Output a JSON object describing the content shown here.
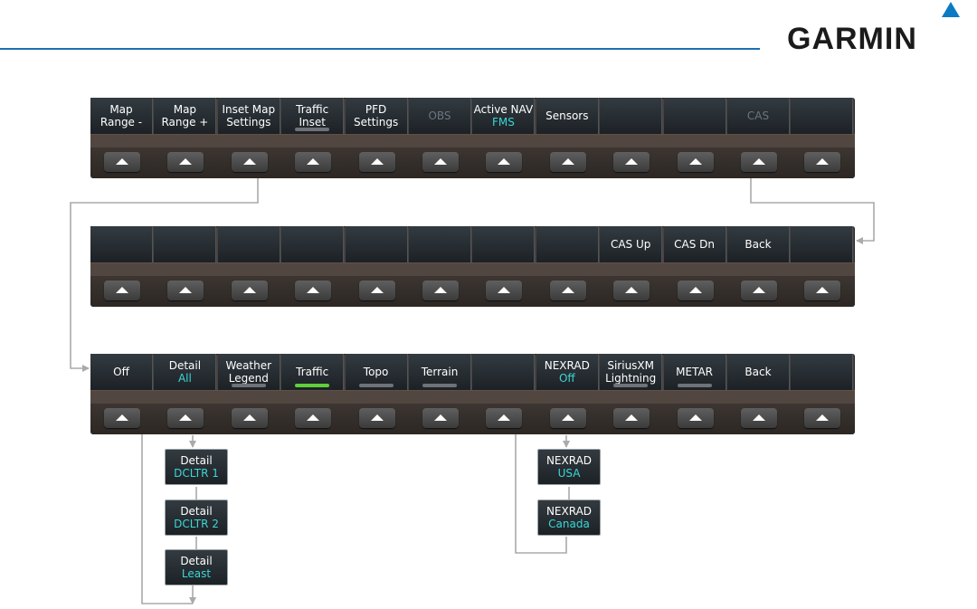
{
  "brand": {
    "logo_text": "GARMIN"
  },
  "colors": {
    "rule": "#1e6fb5",
    "value_text": "#3ad7d7",
    "indicator_on": "#5fcf3a",
    "indicator_off": "#6f7378",
    "connector": "#aaaaaa"
  },
  "top_bar": {
    "keys": [
      {
        "lines": [
          "Map",
          "Range -"
        ]
      },
      {
        "lines": [
          "Map",
          "Range +"
        ]
      },
      {
        "lines": [
          "Inset Map",
          "Settings"
        ]
      },
      {
        "lines": [
          "Traffic",
          "Inset"
        ],
        "indicator": "off"
      },
      {
        "lines": [
          "PFD",
          "Settings"
        ]
      },
      {
        "lines": [
          "OBS"
        ],
        "disabled": true
      },
      {
        "lines": [
          "Active NAV",
          "FMS"
        ],
        "value_line": 1
      },
      {
        "lines": [
          "Sensors"
        ]
      },
      {
        "lines": []
      },
      {
        "lines": []
      },
      {
        "lines": [
          "CAS"
        ],
        "disabled": true
      },
      {
        "lines": []
      }
    ]
  },
  "cas_bar": {
    "keys": [
      {
        "lines": []
      },
      {
        "lines": []
      },
      {
        "lines": []
      },
      {
        "lines": []
      },
      {
        "lines": []
      },
      {
        "lines": []
      },
      {
        "lines": []
      },
      {
        "lines": []
      },
      {
        "lines": [
          "CAS Up"
        ]
      },
      {
        "lines": [
          "CAS Dn"
        ]
      },
      {
        "lines": [
          "Back"
        ]
      },
      {
        "lines": []
      }
    ]
  },
  "inset_bar": {
    "keys": [
      {
        "lines": [
          "Off"
        ]
      },
      {
        "lines": [
          "Detail",
          "All"
        ],
        "value_line": 1
      },
      {
        "lines": [
          "Weather",
          "Legend"
        ],
        "indicator": "off"
      },
      {
        "lines": [
          "Traffic"
        ],
        "indicator": "on"
      },
      {
        "lines": [
          "Topo"
        ],
        "indicator": "off"
      },
      {
        "lines": [
          "Terrain"
        ],
        "indicator": "off"
      },
      {
        "lines": []
      },
      {
        "lines": [
          "NEXRAD",
          "Off"
        ],
        "value_line": 1
      },
      {
        "lines": [
          "SiriusXM",
          "Lightning"
        ],
        "indicator": "off"
      },
      {
        "lines": [
          "METAR"
        ],
        "indicator": "off"
      },
      {
        "lines": [
          "Back"
        ]
      },
      {
        "lines": []
      }
    ]
  },
  "detail_options": [
    {
      "label": "Detail",
      "value": "DCLTR 1"
    },
    {
      "label": "Detail",
      "value": "DCLTR 2"
    },
    {
      "label": "Detail",
      "value": "Least"
    }
  ],
  "nexrad_options": [
    {
      "label": "NEXRAD",
      "value": "USA"
    },
    {
      "label": "NEXRAD",
      "value": "Canada"
    }
  ]
}
